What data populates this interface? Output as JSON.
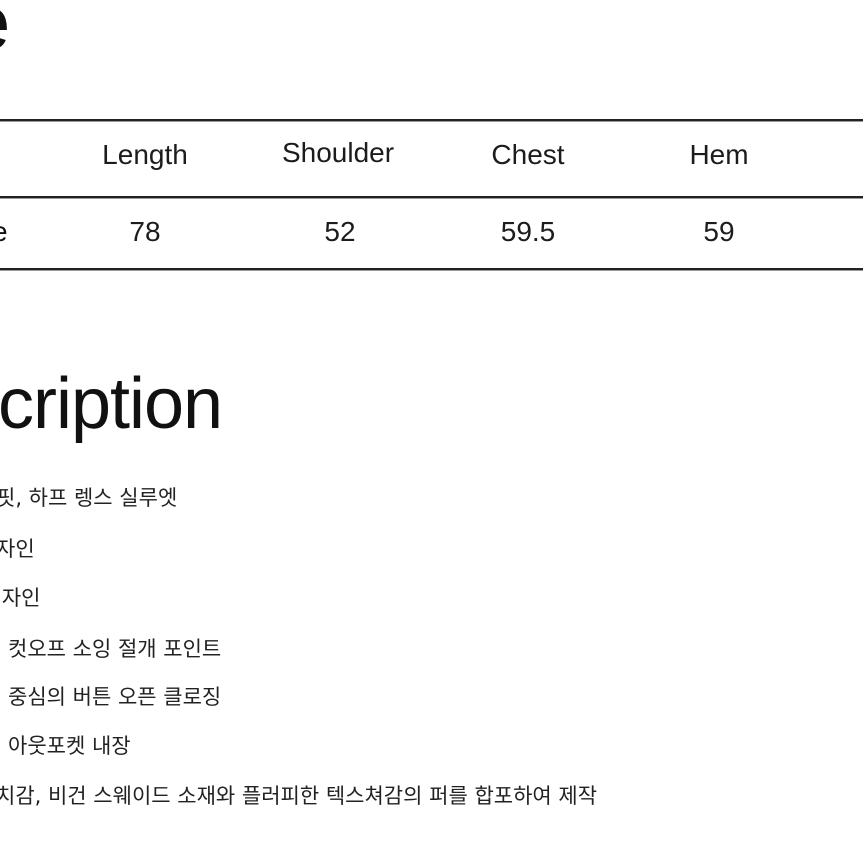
{
  "size_section": {
    "title": "e",
    "table": {
      "columns": [
        "Length",
        "Shoulder",
        "Chest",
        "Hem"
      ],
      "rows": [
        {
          "label": "e",
          "values": [
            "78",
            "52",
            "59.5",
            "59"
          ]
        }
      ]
    }
  },
  "description_section": {
    "title": "cription",
    "items": [
      "핏, 하프 렝스 실루엣",
      "자인",
      "l자인",
      "컷오프 소잉 절개 포인트",
      "중심의 버튼 오픈 클로징",
      "아웃포켓 내장",
      "치감, 비건 스웨이드 소재와 플러피한 텍스쳐감의 퍼를 합포하여 제작"
    ]
  }
}
